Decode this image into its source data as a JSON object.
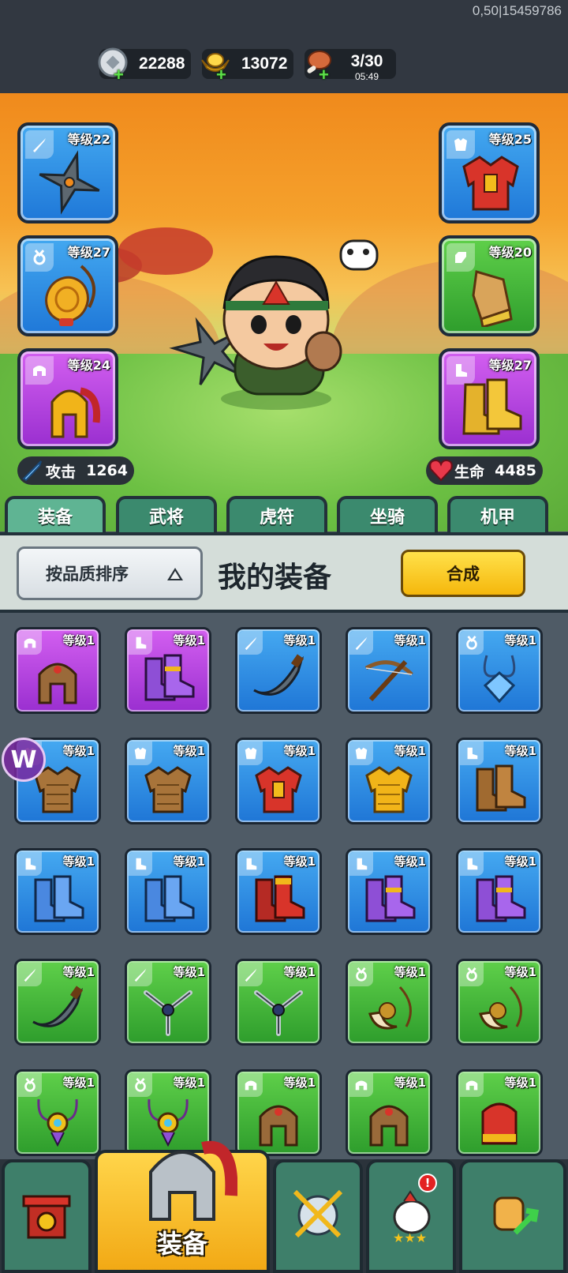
{
  "top": {
    "build_id": "0,50|15459786",
    "resources": [
      {
        "name": "silver-coin",
        "value": "22288",
        "sub": ""
      },
      {
        "name": "gold-ingot",
        "value": "13072",
        "sub": ""
      },
      {
        "name": "meat-stamina",
        "value": "3/30",
        "sub": "05:49"
      }
    ]
  },
  "equipped": {
    "left": [
      {
        "type": "weapon",
        "level": "等级22",
        "color": "blue",
        "item": "shuriken"
      },
      {
        "type": "accessory",
        "level": "等级27",
        "color": "blue",
        "item": "jade-amulet"
      },
      {
        "type": "helmet",
        "level": "等级24",
        "color": "purple",
        "item": "gold-helmet"
      }
    ],
    "right": [
      {
        "type": "armor",
        "level": "等级25",
        "color": "blue",
        "item": "red-armor"
      },
      {
        "type": "gloves",
        "level": "等级20",
        "color": "green",
        "item": "bracer"
      },
      {
        "type": "boots",
        "level": "等级27",
        "color": "purple",
        "item": "gold-boots"
      }
    ]
  },
  "stats": {
    "attack_label": "攻击",
    "attack_value": "1264",
    "hp_label": "生命",
    "hp_value": "4485"
  },
  "tabs": [
    "装备",
    "武将",
    "虎符",
    "坐骑",
    "机甲"
  ],
  "active_tab": 0,
  "sortbar": {
    "sort_label": "按品质排序",
    "title": "我的装备",
    "synthesize_label": "合成"
  },
  "inventory": [
    {
      "type": "helmet",
      "color": "purple",
      "level": "等级1",
      "item": "bronze-helmet"
    },
    {
      "type": "boots",
      "color": "purple",
      "level": "等级1",
      "item": "purple-boots"
    },
    {
      "type": "weapon",
      "color": "blue",
      "level": "等级1",
      "item": "curved-blade"
    },
    {
      "type": "weapon",
      "color": "blue",
      "level": "等级1",
      "item": "crossbow"
    },
    {
      "type": "accessory",
      "color": "blue",
      "level": "等级1",
      "item": "blue-pendant"
    },
    {
      "type": "armor",
      "color": "blue",
      "level": "等级1",
      "item": "leather-armor"
    },
    {
      "type": "armor",
      "color": "blue",
      "level": "等级1",
      "item": "leather-armor"
    },
    {
      "type": "armor",
      "color": "blue",
      "level": "等级1",
      "item": "red-armor"
    },
    {
      "type": "armor",
      "color": "blue",
      "level": "等级1",
      "item": "gold-armor"
    },
    {
      "type": "boots",
      "color": "blue",
      "level": "等级1",
      "item": "brown-boots"
    },
    {
      "type": "boots",
      "color": "blue",
      "level": "等级1",
      "item": "blue-boots"
    },
    {
      "type": "boots",
      "color": "blue",
      "level": "等级1",
      "item": "blue-boots"
    },
    {
      "type": "boots",
      "color": "blue",
      "level": "等级1",
      "item": "red-boots"
    },
    {
      "type": "boots",
      "color": "blue",
      "level": "等级1",
      "item": "purple-boots"
    },
    {
      "type": "boots",
      "color": "blue",
      "level": "等级1",
      "item": "purple-boots"
    },
    {
      "type": "weapon",
      "color": "green",
      "level": "等级1",
      "item": "curved-blade"
    },
    {
      "type": "weapon",
      "color": "green",
      "level": "等级1",
      "item": "shuriken"
    },
    {
      "type": "weapon",
      "color": "green",
      "level": "等级1",
      "item": "shuriken"
    },
    {
      "type": "accessory",
      "color": "green",
      "level": "等级1",
      "item": "horn-charm"
    },
    {
      "type": "accessory",
      "color": "green",
      "level": "等级1",
      "item": "horn-charm"
    },
    {
      "type": "accessory",
      "color": "green",
      "level": "等级1",
      "item": "flower-pendant"
    },
    {
      "type": "accessory",
      "color": "green",
      "level": "等级1",
      "item": "flower-pendant"
    },
    {
      "type": "helmet",
      "color": "green",
      "level": "等级1",
      "item": "bronze-helmet"
    },
    {
      "type": "helmet",
      "color": "green",
      "level": "等级1",
      "item": "bronze-helmet"
    },
    {
      "type": "helmet",
      "color": "green",
      "level": "等级1",
      "item": "red-helmet"
    }
  ],
  "bottom_nav": {
    "items": [
      "shop",
      "equipment",
      "battle",
      "heroes",
      "upgrade"
    ],
    "active_label": "装备",
    "alert_badge": "!"
  },
  "colors": {
    "blue": "#2f8fe6",
    "green": "#45b83a",
    "purple": "#b847e0",
    "gold": "#f5c020",
    "tab": "#3b8a6e"
  }
}
